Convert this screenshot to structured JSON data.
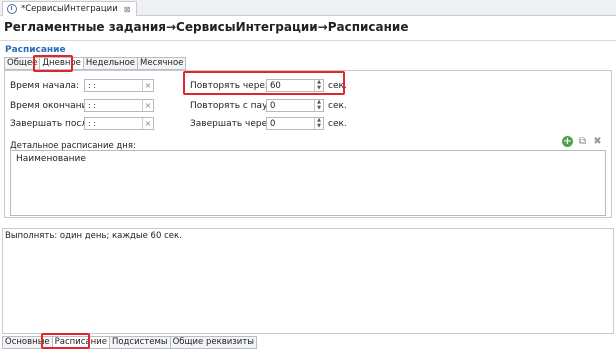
{
  "editor_tab": {
    "title": "*СервисыИнтеграции",
    "close": "⊠"
  },
  "page": {
    "title": "Регламентные задания→СервисыИнтеграции→Расписание"
  },
  "section": {
    "title": "Расписание"
  },
  "inner_tabs": [
    "Общее",
    "Дневное",
    "Недельное",
    "Месячное"
  ],
  "form": {
    "start_time": {
      "label": "Время начала:",
      "value": ": :"
    },
    "end_time": {
      "label": "Время окончания:",
      "value": ": :"
    },
    "finish_after": {
      "label": "Завершать после:",
      "value": ": :"
    },
    "repeat_every": {
      "label": "Повторять через:",
      "value": "60",
      "unit": "сек."
    },
    "repeat_pause": {
      "label": "Повторять с паузой:",
      "value": "0",
      "unit": "сек."
    },
    "finish_through": {
      "label": "Завершать через:",
      "value": "0",
      "unit": "сек."
    },
    "clear_symbol": "×"
  },
  "detail": {
    "label": "Детальное расписание дня:",
    "column": "Наименование"
  },
  "summary": {
    "text": "Выполнять: один день; каждые 60 сек."
  },
  "bottom_tabs": [
    "Основные",
    "Расписание",
    "Подсистемы",
    "Общие реквизиты"
  ],
  "colors": {
    "highlight": "#e0262a",
    "section_title": "#2a6bb8"
  },
  "icons": {
    "plus": "+",
    "copy": "⧉",
    "delete": "✖",
    "spin_up": "▲",
    "spin_down": "▼"
  }
}
